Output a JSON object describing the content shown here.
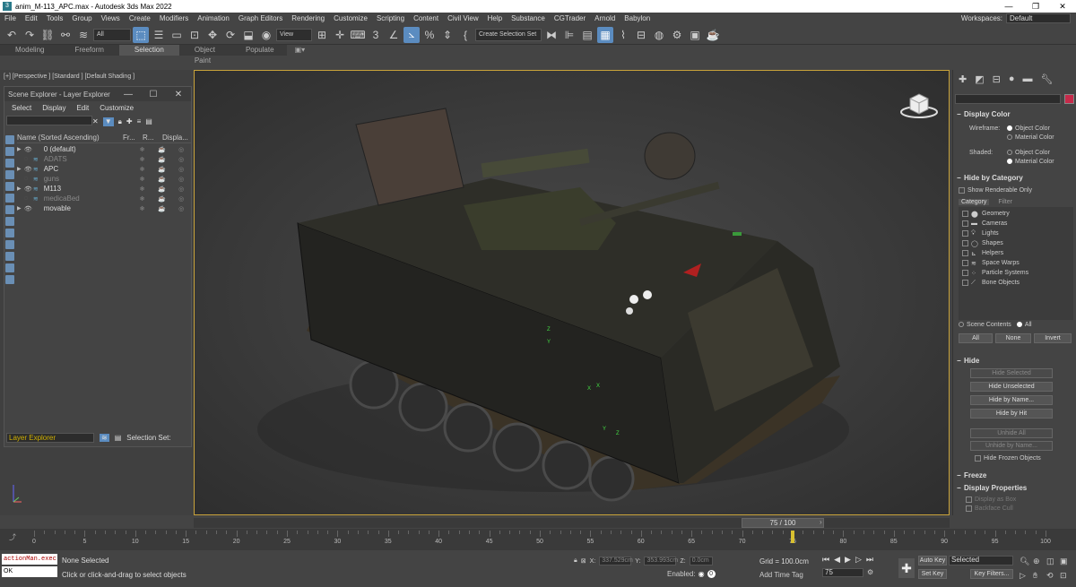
{
  "window": {
    "title": "anim_M-113_APC.max - Autodesk 3ds Max 2022",
    "controls": [
      "—",
      "❐",
      "✕"
    ]
  },
  "menu": {
    "items": [
      "File",
      "Edit",
      "Tools",
      "Group",
      "Views",
      "Create",
      "Modifiers",
      "Animation",
      "Graph Editors",
      "Rendering",
      "Customize",
      "Scripting",
      "Content",
      "Civil View",
      "Help",
      "Substance",
      "CGTrader",
      "Arnold",
      "Babylon"
    ],
    "workspace_label": "Workspaces:",
    "workspace_value": "Default"
  },
  "toolbar": {
    "filter_value": "All",
    "ref_coord_value": "View",
    "selection_set_placeholder": "Create Selection Set"
  },
  "ribbon": {
    "tabs": [
      "Modeling",
      "Freeform",
      "Selection",
      "Object Paint",
      "Populate"
    ],
    "active": "Selection"
  },
  "viewport": {
    "label": "[+] [Perspective ] [Standard ] [Default Shading ]",
    "axis_labels": [
      "Z",
      "Y",
      "X",
      "Z",
      "Y",
      "X"
    ]
  },
  "scene_explorer": {
    "title": "Scene Explorer - Layer Explorer",
    "menu": [
      "Select",
      "Display",
      "Edit",
      "Customize"
    ],
    "columns": [
      "Name (Sorted Ascending)",
      "Fr...",
      "R...",
      "Displa..."
    ],
    "rows": [
      {
        "name": "0 (default)",
        "expandable": true,
        "visible": true,
        "dim": false
      },
      {
        "name": "ADATS",
        "expandable": false,
        "visible": false,
        "dim": true
      },
      {
        "name": "APC",
        "expandable": true,
        "visible": true,
        "dim": false
      },
      {
        "name": "guns",
        "expandable": false,
        "visible": false,
        "dim": true
      },
      {
        "name": "M113",
        "expandable": true,
        "visible": true,
        "dim": false
      },
      {
        "name": "medicaBed",
        "expandable": false,
        "visible": false,
        "dim": true
      },
      {
        "name": "movable",
        "expandable": true,
        "visible": true,
        "dim": false
      }
    ],
    "footer_dropdown": "Layer Explorer",
    "footer_label": "Selection Set:"
  },
  "command_panel": {
    "display_color": {
      "title": "Display Color",
      "wireframe_label": "Wireframe:",
      "shaded_label": "Shaded:",
      "opt_object": "Object Color",
      "opt_material": "Material Color"
    },
    "hide_by_category": {
      "title": "Hide by Category",
      "show_renderable": "Show Renderable Only",
      "tabs": [
        "Category",
        "Filter"
      ],
      "items": [
        "Geometry",
        "Cameras",
        "Lights",
        "Shapes",
        "Helpers",
        "Space Warps",
        "Particle Systems",
        "Bone Objects"
      ],
      "scene_contents": "Scene Contents",
      "all_radio": "All",
      "buttons": [
        "All",
        "None",
        "Invert"
      ]
    },
    "hide": {
      "title": "Hide",
      "buttons": [
        "Hide Selected",
        "Hide Unselected",
        "Hide by Name...",
        "Hide by Hit",
        "Unhide All",
        "Unhide by Name..."
      ],
      "hide_frozen": "Hide Frozen Objects"
    },
    "freeze": {
      "title": "Freeze"
    },
    "display_properties": {
      "title": "Display Properties",
      "items": [
        "Display as Box",
        "Backface Cull"
      ]
    },
    "selection_swatch_color": "#c62a4a"
  },
  "timeline": {
    "current": "75 / 100",
    "current_frame": 75,
    "ticks": [
      0,
      5,
      10,
      15,
      20,
      25,
      30,
      35,
      40,
      45,
      50,
      55,
      60,
      65,
      70,
      75,
      80,
      85,
      90,
      95,
      100
    ]
  },
  "status": {
    "maxscript_line": "actionMan.exec",
    "maxscript_result": "OK",
    "selection": "None Selected",
    "prompt": "Click or click-and-drag to select objects",
    "x_label": "X:",
    "x_value": "337.529cm",
    "y_label": "Y:",
    "y_value": "353.993cm",
    "z_label": "Z:",
    "z_value": "0.0cm",
    "grid": "Grid = 100.0cm",
    "enabled_label": "Enabled:",
    "add_time_tag": "Add Time Tag",
    "frame_field": "75",
    "auto_key": "Auto Key",
    "set_key": "Set Key",
    "key_mode": "Selected",
    "key_filters": "Key Filters..."
  }
}
